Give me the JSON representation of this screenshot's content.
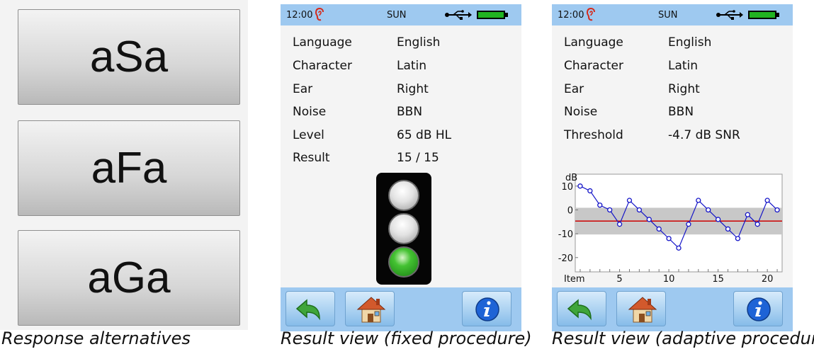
{
  "response_panel": {
    "alternatives": [
      "aSa",
      "aFa",
      "aGa"
    ],
    "caption": "Response alternatives"
  },
  "fixed_view": {
    "status": {
      "time": "12:00",
      "day": "SUN"
    },
    "rows": [
      {
        "label": "Language",
        "value": "English"
      },
      {
        "label": "Character",
        "value": "Latin"
      },
      {
        "label": "Ear",
        "value": "Right"
      },
      {
        "label": "Noise",
        "value": "BBN"
      },
      {
        "label": "Level",
        "value": "65 dB HL"
      },
      {
        "label": "Result",
        "value": "15 / 15"
      }
    ],
    "traffic_light": {
      "lit": "green"
    },
    "toolbar_icons": [
      "back-arrow-icon",
      "home-icon",
      "info-icon"
    ],
    "caption": "Result view (fixed procedure)"
  },
  "adaptive_view": {
    "status": {
      "time": "12:00",
      "day": "SUN"
    },
    "rows": [
      {
        "label": "Language",
        "value": "English"
      },
      {
        "label": "Character",
        "value": "Latin"
      },
      {
        "label": "Ear",
        "value": "Right"
      },
      {
        "label": "Noise",
        "value": "BBN"
      },
      {
        "label": "Threshold",
        "value": "-4.7 dB SNR"
      }
    ],
    "toolbar_icons": [
      "back-arrow-icon",
      "home-icon",
      "info-icon"
    ],
    "caption": "Result view (adaptive procedure)"
  },
  "chart_data": {
    "type": "line",
    "ylabel": "dB",
    "xlabel": "Item",
    "x": [
      1,
      2,
      3,
      4,
      5,
      6,
      7,
      8,
      9,
      10,
      11,
      12,
      13,
      14,
      15,
      16,
      17,
      18,
      19,
      20,
      21
    ],
    "y": [
      10,
      8,
      2,
      0,
      -6,
      4,
      0,
      -4,
      -8,
      -12,
      -16,
      -6,
      4,
      0,
      -4,
      -8,
      -12,
      -2,
      -6,
      4,
      0
    ],
    "ylim": [
      -26,
      15
    ],
    "xlim": [
      0.5,
      21.5
    ],
    "xticks": [
      "5",
      "10",
      "15",
      "20"
    ],
    "yticks": [
      "10",
      "0",
      "-10",
      "-20"
    ],
    "threshold_line": -4.7,
    "band": [
      -10.3,
      0.9
    ],
    "colors": {
      "line": "#1414c8",
      "threshold": "#cc0000",
      "band": "#c8c8c8"
    }
  }
}
